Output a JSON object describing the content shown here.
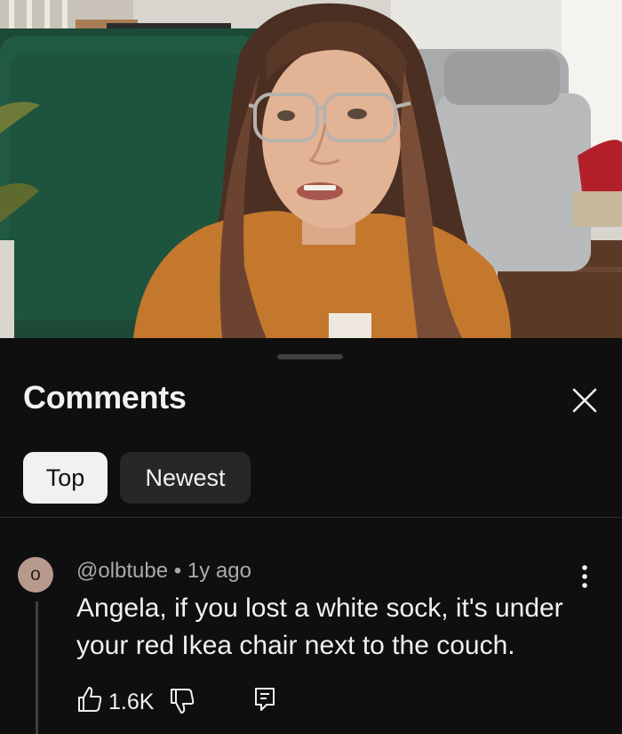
{
  "sheet": {
    "title": "Comments",
    "close_icon": "close-icon",
    "sort_tabs": [
      {
        "label": "Top",
        "selected": true
      },
      {
        "label": "Newest",
        "selected": false
      }
    ]
  },
  "comment": {
    "avatar_letter": "o",
    "author": "@olbtube",
    "separator": " • ",
    "time": "1y ago",
    "text": "Angela, if you lost a white sock, it's under your red Ikea chair next to the couch.",
    "likes": "1.6K",
    "icons": {
      "more": "more-vertical-icon",
      "like": "thumbs-up-icon",
      "dislike": "thumbs-down-icon",
      "reply": "reply-comment-icon"
    }
  },
  "colors": {
    "background": "#0f0f0f",
    "selected_chip": "#f1f1f1",
    "unselected_chip": "#272727",
    "secondary_text": "#aaaaaa",
    "avatar": "#b79a8d"
  }
}
